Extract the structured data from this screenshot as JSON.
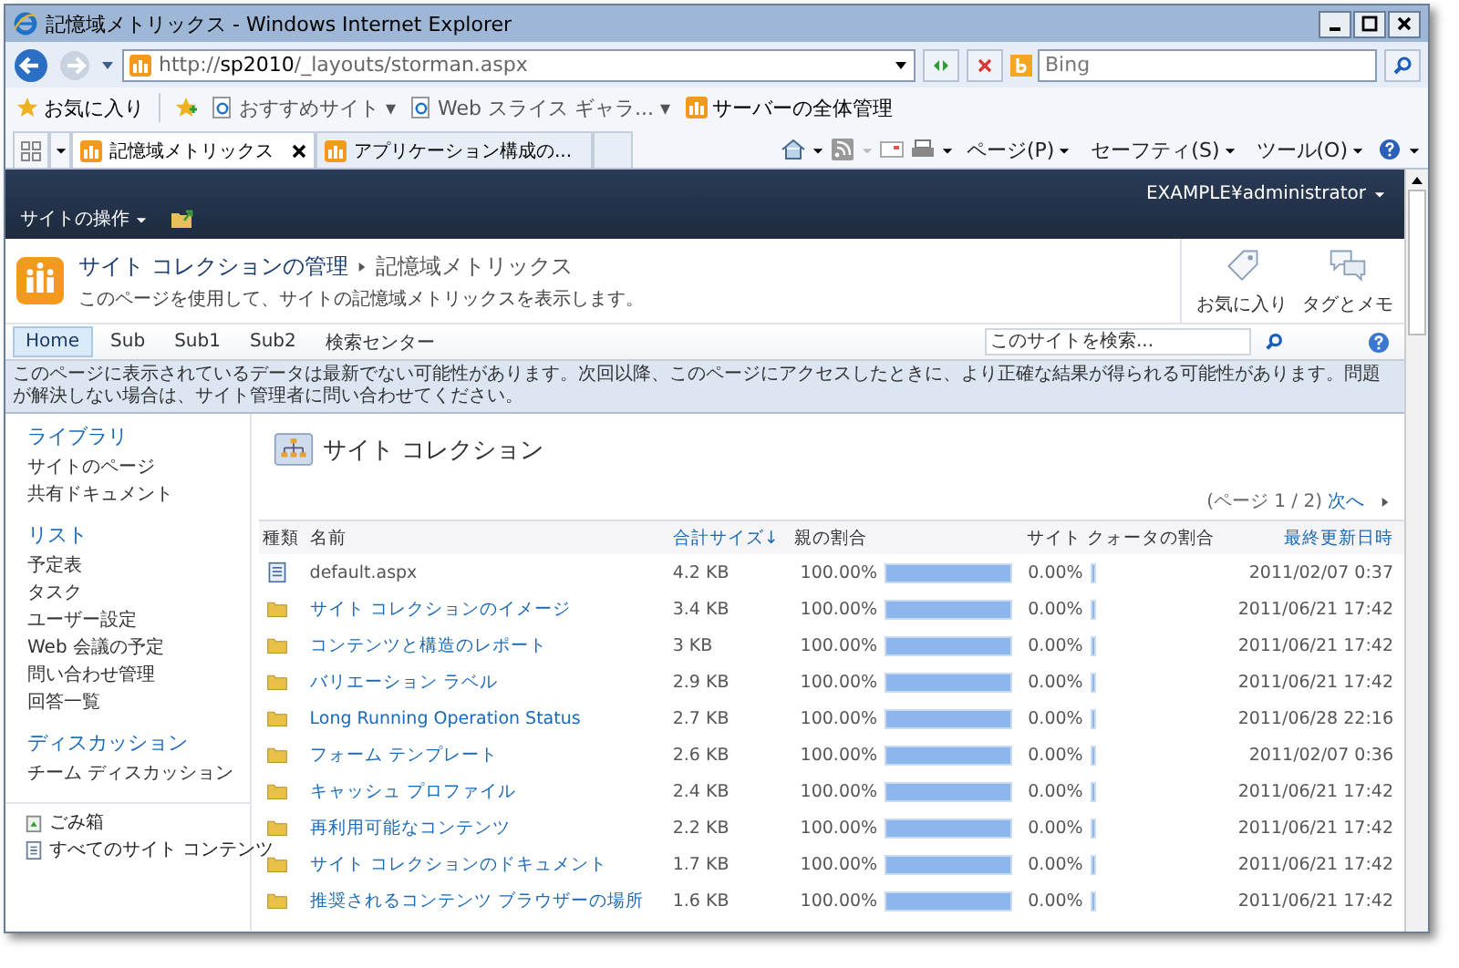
{
  "window": {
    "title": "記憶域メトリックス - Windows Internet Explorer"
  },
  "address_bar": {
    "url_prefix": "http://",
    "url_host": "sp2010",
    "url_path": "/_layouts/storman.aspx",
    "search_placeholder": "Bing"
  },
  "favorites_bar": {
    "items": [
      {
        "kind": "star",
        "label": "お気に入り"
      },
      {
        "kind": "add"
      },
      {
        "kind": "ie",
        "label": "おすすめサイト ▾"
      },
      {
        "kind": "ie",
        "label": "Web スライス ギャラ... ▾"
      },
      {
        "kind": "sp",
        "label": "サーバーの全体管理"
      }
    ]
  },
  "tabs": [
    {
      "label": "記憶域メトリックス",
      "selected": true
    },
    {
      "label": "アプリケーション構成の...",
      "selected": false
    }
  ],
  "command_bar": [
    "ページ(P)",
    "セーフティ(S)",
    "ツール(O)"
  ],
  "ribbon": {
    "site_actions": "サイトの操作",
    "user": "EXAMPLE¥administrator"
  },
  "header": {
    "breadcrumb_root": "サイト コレクションの管理",
    "breadcrumb_current": "記憶域メトリックス",
    "description": "このページを使用して、サイトの記憶域メトリックスを表示します。",
    "actions": [
      "お気に入り",
      "タグとメモ"
    ]
  },
  "top_nav": [
    {
      "label": "Home",
      "selected": true
    },
    {
      "label": "Sub",
      "selected": false
    },
    {
      "label": "Sub1",
      "selected": false
    },
    {
      "label": "Sub2",
      "selected": false
    },
    {
      "label": "検索センター",
      "selected": false
    }
  ],
  "search": {
    "placeholder": "このサイトを検索..."
  },
  "warning": "このページに表示されているデータは最新でない可能性があります。次回以降、このページにアクセスしたときに、より正確な結果が得られる可能性があります。問題が解決しない場合は、サイト管理者に問い合わせてください。",
  "sidebar": {
    "sections": [
      {
        "heading": "ライブラリ",
        "items": [
          "サイトのページ",
          "共有ドキュメント"
        ]
      },
      {
        "heading": "リスト",
        "items": [
          "予定表",
          "タスク",
          "ユーザー設定",
          "Web 会議の予定",
          "問い合わせ管理",
          "回答一覧"
        ]
      },
      {
        "heading": "ディスカッション",
        "items": [
          "チーム ディスカッション"
        ]
      }
    ],
    "footer": [
      {
        "kind": "recycle",
        "label": "ごみ箱"
      },
      {
        "kind": "content",
        "label": "すべてのサイト コンテンツ"
      }
    ]
  },
  "content": {
    "title": "サイト コレクション",
    "pager": "(ページ 1 / 2)",
    "next": "次へ"
  },
  "table": {
    "columns": [
      "種類",
      "名前",
      "合計サイズ↓",
      "親の割合",
      "サイト クォータの割合",
      "最終更新日時"
    ],
    "rows": [
      {
        "kind": "file",
        "name": "default.aspx",
        "size": "4.2 KB",
        "parent_pct": "100.00%",
        "parent_bar": {
          "level": 1
        },
        "quota_pct": "0.00%",
        "quota_bar": {
          "level": 0.03
        },
        "modified": "2011/02/07 0:37"
      },
      {
        "kind": "folder",
        "name": "サイト コレクションのイメージ",
        "size": "3.4 KB",
        "parent_pct": "100.00%",
        "parent_bar": {
          "level": 1
        },
        "quota_pct": "0.00%",
        "quota_bar": {
          "level": 0.03
        },
        "modified": "2011/06/21 17:42"
      },
      {
        "kind": "folder",
        "name": "コンテンツと構造のレポート",
        "size": "3 KB",
        "parent_pct": "100.00%",
        "parent_bar": {
          "level": 1
        },
        "quota_pct": "0.00%",
        "quota_bar": {
          "level": 0.03
        },
        "modified": "2011/06/21 17:42"
      },
      {
        "kind": "folder",
        "name": "バリエーション ラベル",
        "size": "2.9 KB",
        "parent_pct": "100.00%",
        "parent_bar": {
          "level": 1
        },
        "quota_pct": "0.00%",
        "quota_bar": {
          "level": 0.03
        },
        "modified": "2011/06/21 17:42"
      },
      {
        "kind": "folder",
        "name": "Long Running Operation Status",
        "size": "2.7 KB",
        "parent_pct": "100.00%",
        "parent_bar": {
          "level": 1
        },
        "quota_pct": "0.00%",
        "quota_bar": {
          "level": 0.03
        },
        "modified": "2011/06/28 22:16"
      },
      {
        "kind": "folder",
        "name": "フォーム テンプレート",
        "size": "2.6 KB",
        "parent_pct": "100.00%",
        "parent_bar": {
          "level": 1
        },
        "quota_pct": "0.00%",
        "quota_bar": {
          "level": 0.03
        },
        "modified": "2011/02/07 0:36"
      },
      {
        "kind": "folder",
        "name": "キャッシュ プロファイル",
        "size": "2.4 KB",
        "parent_pct": "100.00%",
        "parent_bar": {
          "level": 1
        },
        "quota_pct": "0.00%",
        "quota_bar": {
          "level": 0.03
        },
        "modified": "2011/06/21 17:42"
      },
      {
        "kind": "folder",
        "name": "再利用可能なコンテンツ",
        "size": "2.2 KB",
        "parent_pct": "100.00%",
        "parent_bar": {
          "level": 1
        },
        "quota_pct": "0.00%",
        "quota_bar": {
          "level": 0.03
        },
        "modified": "2011/06/21 17:42"
      },
      {
        "kind": "folder",
        "name": "サイト コレクションのドキュメント",
        "size": "1.7 KB",
        "parent_pct": "100.00%",
        "parent_bar": {
          "level": 1
        },
        "quota_pct": "0.00%",
        "quota_bar": {
          "level": 0.03
        },
        "modified": "2011/06/21 17:42"
      },
      {
        "kind": "folder",
        "name": "推奨されるコンテンツ ブラウザーの場所",
        "size": "1.6 KB",
        "parent_pct": "100.00%",
        "parent_bar": {
          "level": 1
        },
        "quota_pct": "0.00%",
        "quota_bar": {
          "level": 0.03
        },
        "modified": "2011/06/21 17:42"
      }
    ]
  }
}
